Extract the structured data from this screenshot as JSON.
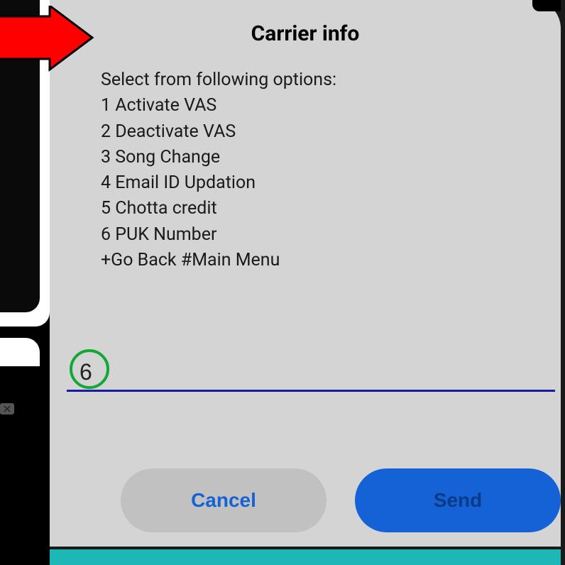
{
  "dialog": {
    "title": "Carrier info",
    "prompt": "Select from following options:",
    "options": [
      "1 Activate VAS",
      "2 Deactivate VAS",
      "3 Song Change",
      "4 Email ID Updation",
      "5 Chotta credit",
      "6 PUK Number",
      "+Go Back #Main Menu"
    ],
    "input_value": "6",
    "cancel_label": "Cancel",
    "send_label": "Send"
  }
}
